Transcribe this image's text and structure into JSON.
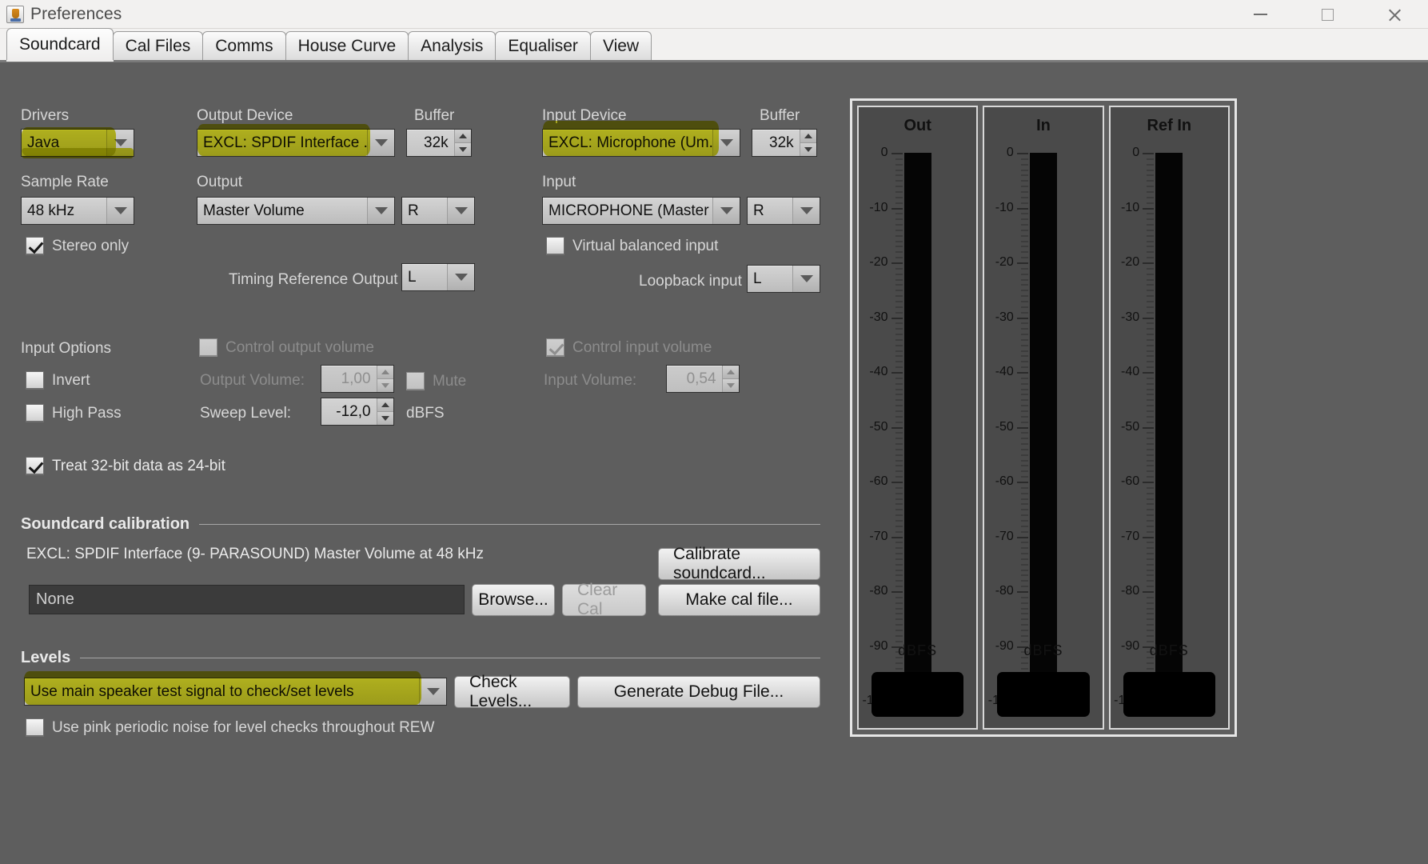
{
  "window": {
    "title": "Preferences",
    "icon": "java-cup-icon",
    "controls": {
      "minimize": "minimize-icon",
      "maximize": "maximize-icon",
      "close": "close-icon"
    }
  },
  "tabs": [
    {
      "label": "Soundcard",
      "active": true
    },
    {
      "label": "Cal Files",
      "active": false
    },
    {
      "label": "Comms",
      "active": false
    },
    {
      "label": "House Curve",
      "active": false
    },
    {
      "label": "Analysis",
      "active": false
    },
    {
      "label": "Equaliser",
      "active": false
    },
    {
      "label": "View",
      "active": false
    }
  ],
  "soundcard": {
    "drivers": {
      "label": "Drivers",
      "value": "Java",
      "highlighted": true
    },
    "sample_rate": {
      "label": "Sample Rate",
      "value": "48 kHz"
    },
    "stereo_only": {
      "label": "Stereo only",
      "checked": true
    },
    "output_device": {
      "label": "Output Device",
      "value": "EXCL: SPDIF Interface ...",
      "highlighted": true
    },
    "output_buffer": {
      "label": "Buffer",
      "value": "32k"
    },
    "output": {
      "label": "Output",
      "value": "Master Volume",
      "channel": "R"
    },
    "timing_reference_output": {
      "label": "Timing Reference Output",
      "value": "L"
    },
    "input_device": {
      "label": "Input Device",
      "value": "EXCL: Microphone (Um...",
      "highlighted": true
    },
    "input_buffer": {
      "label": "Buffer",
      "value": "32k"
    },
    "input": {
      "label": "Input",
      "value": "MICROPHONE (Master ...",
      "channel": "R"
    },
    "virtual_balanced_input": {
      "label": "Virtual balanced input",
      "checked": false
    },
    "loopback_input": {
      "label": "Loopback input",
      "value": "L"
    }
  },
  "input_options": {
    "title": "Input Options",
    "invert": {
      "label": "Invert",
      "checked": false
    },
    "high_pass": {
      "label": "High Pass",
      "checked": false
    },
    "control_output_volume": {
      "label": "Control output volume",
      "checked": false,
      "disabled": true
    },
    "output_volume": {
      "label": "Output Volume:",
      "value": "1,00",
      "disabled": true
    },
    "mute": {
      "label": "Mute",
      "checked": false,
      "disabled": true
    },
    "sweep_level": {
      "label": "Sweep Level:",
      "value": "-12,0",
      "unit": "dBFS"
    },
    "control_input_volume": {
      "label": "Control input volume",
      "checked": true,
      "disabled": true
    },
    "input_volume": {
      "label": "Input Volume:",
      "value": "0,54",
      "disabled": true
    },
    "treat_32bit": {
      "label": "Treat 32-bit data as 24-bit",
      "checked": true
    }
  },
  "calibration": {
    "title": "Soundcard calibration",
    "device_line": "EXCL: SPDIF Interface (9- PARASOUND) Master Volume at 48 kHz",
    "cal_file_value": "None",
    "calibrate_button": "Calibrate soundcard...",
    "browse_button": "Browse...",
    "clear_cal_button": "Clear Cal",
    "make_cal_button": "Make cal file..."
  },
  "levels": {
    "title": "Levels",
    "selector_value": "Use main speaker test signal to check/set levels",
    "selector_highlighted": true,
    "check_levels_button": "Check Levels...",
    "generate_debug_button": "Generate Debug File...",
    "pink_noise": {
      "label": "Use pink periodic noise for level checks throughout REW",
      "checked": false
    }
  },
  "meters": {
    "unit": "dBFS",
    "scale_labels": [
      "0",
      "-10",
      "-20",
      "-30",
      "-40",
      "-50",
      "-60",
      "-70",
      "-80",
      "-90",
      "-100"
    ],
    "scale_min": -100,
    "scale_max": 0,
    "columns": [
      {
        "title": "Out",
        "level": -97
      },
      {
        "title": "In",
        "level": -97
      },
      {
        "title": "Ref In",
        "level": -97
      }
    ]
  },
  "colors": {
    "panel_bg": "#5e5e5e",
    "highlight": "#cccc00",
    "titlebar_bg": "#f2f1f0"
  }
}
